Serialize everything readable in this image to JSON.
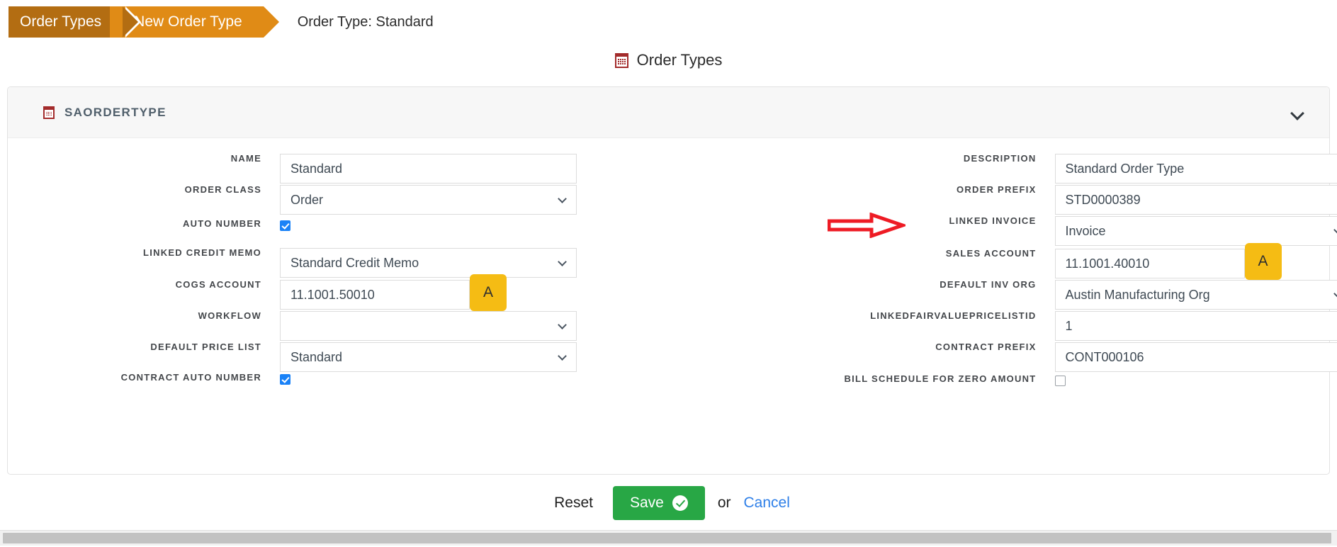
{
  "breadcrumb": {
    "items": [
      {
        "label": "Order Types",
        "color": "#b36d12"
      },
      {
        "label": "New Order Type",
        "color": "#e08b16"
      }
    ],
    "page_title": "Order Type: Standard"
  },
  "page_heading": {
    "icon": "grid-icon",
    "label": "Order Types"
  },
  "card": {
    "icon": "grid-icon",
    "title": "SAORDERTYPE",
    "collapse_icon": "chevron-down-icon"
  },
  "form": {
    "left_fields": [
      {
        "label": "NAME",
        "type": "text",
        "value": "Standard"
      },
      {
        "label": "ORDER CLASS",
        "type": "select",
        "value": "Order"
      },
      {
        "label": "AUTO NUMBER",
        "type": "checkbox",
        "checked": true
      },
      {
        "label": "LINKED CREDIT MEMO",
        "type": "select",
        "value": "Standard Credit Memo"
      },
      {
        "label": "COGS ACCOUNT",
        "type": "text_with_button",
        "value": "11.1001.50010",
        "button_label": "A"
      },
      {
        "label": "WORKFLOW",
        "type": "select",
        "value": ""
      },
      {
        "label": "DEFAULT PRICE LIST",
        "type": "select",
        "value": "Standard"
      },
      {
        "label": "CONTRACT AUTO NUMBER",
        "type": "checkbox",
        "checked": true
      }
    ],
    "right_fields": [
      {
        "label": "DESCRIPTION",
        "type": "text",
        "value": "Standard Order Type"
      },
      {
        "label": "ORDER PREFIX",
        "type": "text",
        "value": "STD0000389",
        "annotated": true
      },
      {
        "label": "LINKED INVOICE",
        "type": "select",
        "value": "Invoice"
      },
      {
        "label": "SALES ACCOUNT",
        "type": "text_with_button",
        "value": "11.1001.40010",
        "button_label": "A"
      },
      {
        "label": "DEFAULT INV ORG",
        "type": "select",
        "value": "Austin Manufacturing Org"
      },
      {
        "label": "LINKEDFAIRVALUEPRICELISTID",
        "type": "text",
        "value": "1"
      },
      {
        "label": "CONTRACT PREFIX",
        "type": "text",
        "value": "CONT000106"
      },
      {
        "label": "BILL SCHEDULE FOR ZERO AMOUNT",
        "type": "checkbox",
        "checked": false
      }
    ]
  },
  "annotation": {
    "arrow_color": "#ee1b24",
    "points_to": "ORDER PREFIX"
  },
  "footer": {
    "reset_label": "Reset",
    "save_label": "Save",
    "save_icon": "check-circle-icon",
    "or_label": "or",
    "cancel_label": "Cancel",
    "save_color": "#28a745",
    "cancel_color": "#2e7fe8"
  }
}
